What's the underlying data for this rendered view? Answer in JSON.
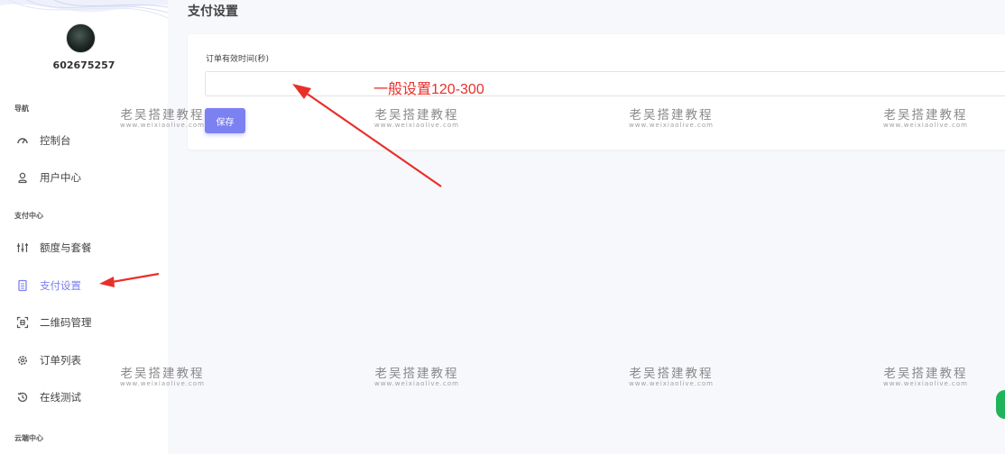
{
  "page_title": "支付设置",
  "user": {
    "name": "602675257"
  },
  "sidebar": {
    "section_nav": "导航",
    "section_pay": "支付中心",
    "section_cloud": "云端中心",
    "items": [
      {
        "label": "控制台",
        "icon": "dashboard-icon"
      },
      {
        "label": "用户中心",
        "icon": "user-icon"
      },
      {
        "label": "额度与套餐",
        "icon": "sliders-icon"
      },
      {
        "label": "支付设置",
        "icon": "document-icon",
        "active": true
      },
      {
        "label": "二维码管理",
        "icon": "qrcode-icon"
      },
      {
        "label": "订单列表",
        "icon": "gear-icon"
      },
      {
        "label": "在线测试",
        "icon": "history-icon"
      }
    ]
  },
  "form": {
    "field_label": "订单有效时间(秒)",
    "field_value": "",
    "save_label": "保存"
  },
  "annotation": {
    "text": "一般设置120-300",
    "color": "#e8302a"
  },
  "watermark": {
    "title": "老吴搭建教程",
    "url": "www.weixiaolive.com"
  },
  "colors": {
    "accent": "#7c81f2",
    "annotation": "#e8302a",
    "background": "#f7f8fc"
  }
}
